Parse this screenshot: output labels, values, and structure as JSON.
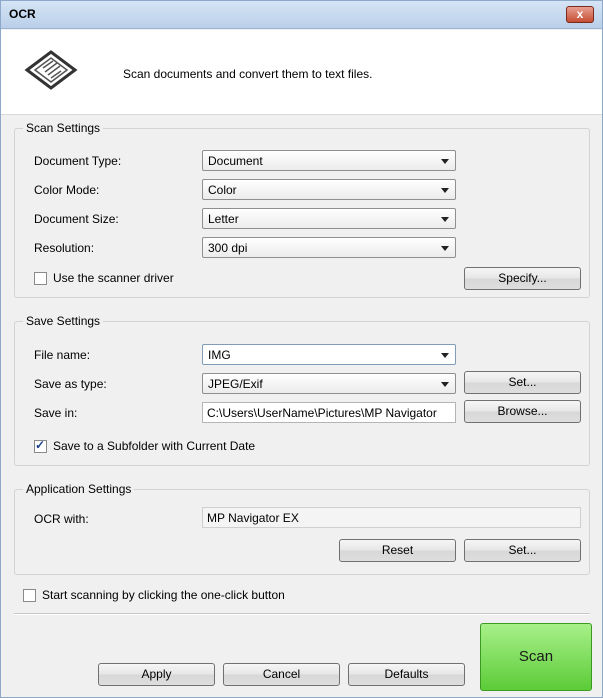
{
  "window": {
    "title": "OCR",
    "close_label": "x"
  },
  "header": {
    "description": "Scan documents and convert them to text files.",
    "icon": "scan-document-icon"
  },
  "scan_settings": {
    "group_label": "Scan Settings",
    "document_type": {
      "label": "Document Type:",
      "value": "Document"
    },
    "color_mode": {
      "label": "Color Mode:",
      "value": "Color"
    },
    "document_size": {
      "label": "Document Size:",
      "value": "Letter"
    },
    "resolution": {
      "label": "Resolution:",
      "value": "300 dpi"
    },
    "use_scanner_driver": {
      "label": "Use the scanner driver",
      "checked": false
    },
    "specify_label": "Specify..."
  },
  "save_settings": {
    "group_label": "Save Settings",
    "file_name": {
      "label": "File name:",
      "value": "IMG"
    },
    "save_as_type": {
      "label": "Save as type:",
      "value": "JPEG/Exif"
    },
    "set_label": "Set...",
    "save_in": {
      "label": "Save in:",
      "value": "C:\\Users\\UserName\\Pictures\\MP Navigator"
    },
    "browse_label": "Browse...",
    "subfolder": {
      "label": "Save to a Subfolder with Current Date",
      "checked": true
    }
  },
  "application_settings": {
    "group_label": "Application Settings",
    "ocr_with": {
      "label": "OCR with:",
      "value": "MP Navigator EX"
    },
    "reset_label": "Reset",
    "set_label": "Set..."
  },
  "one_click": {
    "label": "Start scanning by clicking the one-click button",
    "checked": false
  },
  "footer": {
    "apply_label": "Apply",
    "cancel_label": "Cancel",
    "defaults_label": "Defaults",
    "scan_label": "Scan"
  },
  "colors": {
    "scan_button": "#6fd64a",
    "titlebar": "#c9dbf0",
    "close_button": "#c44d32"
  }
}
